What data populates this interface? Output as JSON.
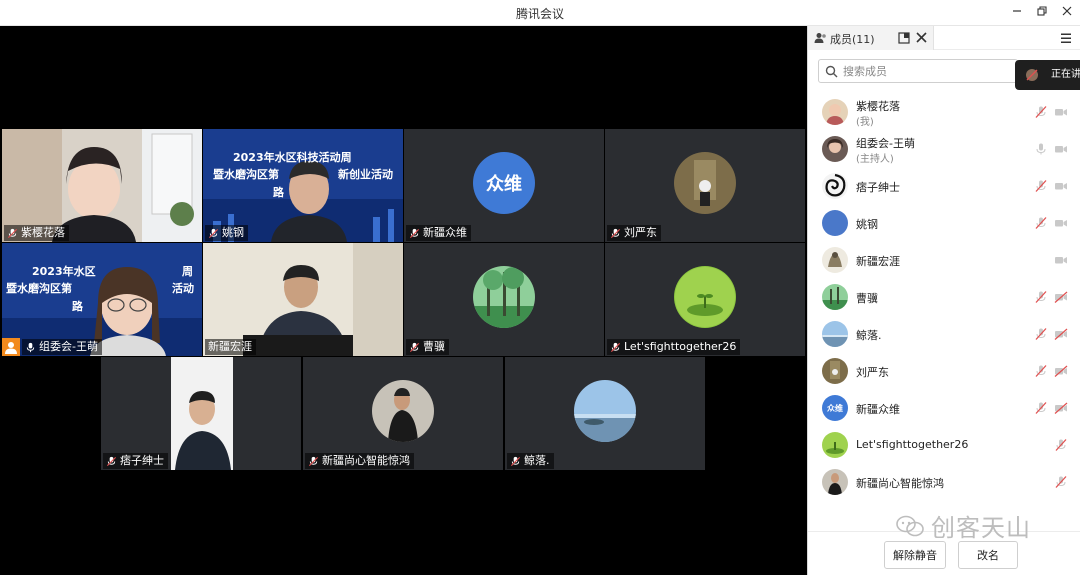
{
  "window": {
    "title": "腾讯会议"
  },
  "tiles": [
    {
      "name": "紫樱花落"
    },
    {
      "name": "姚钢",
      "banner_line1": "2023年水区科技活动周",
      "banner_line2": "暨水磨沟区第",
      "banner_line2b": "新创业活动",
      "banner_line3": "路"
    },
    {
      "name": "新疆众维",
      "avatar_text": "众维"
    },
    {
      "name": "刘严东"
    },
    {
      "name": "组委会-王萌",
      "banner_line1": "2023年水区",
      "banner_line1b": "周",
      "banner_line2": "暨水磨沟区第",
      "banner_line2b": "活动",
      "banner_line3": "路"
    },
    {
      "name": "新疆宏涯"
    },
    {
      "name": "曹骥"
    },
    {
      "name": "Let'sfighttogether26"
    },
    {
      "name": "痞子绅士"
    },
    {
      "name": "新疆尚心智能惊鸿"
    },
    {
      "name": "鲸落."
    }
  ],
  "panel": {
    "tab_label": "成员(11)",
    "search_placeholder": "搜索成员",
    "speaking_label": "正在讲",
    "members": [
      {
        "name": "紫樱花落",
        "sub": "(我)"
      },
      {
        "name": "组委会-王萌",
        "sub": "(主持人)"
      },
      {
        "name": "痞子绅士"
      },
      {
        "name": "姚钢"
      },
      {
        "name": "新疆宏涯"
      },
      {
        "name": "曹骥"
      },
      {
        "name": "鲸落."
      },
      {
        "name": "刘严东"
      },
      {
        "name": "新疆众维",
        "avatar_text": "众维"
      },
      {
        "name": "Let'sfighttogether26"
      },
      {
        "name": "新疆尚心智能惊鸿"
      }
    ],
    "unmute_label": "解除静音",
    "rename_label": "改名"
  },
  "watermark": {
    "text": "创客天山"
  },
  "colors": {
    "active_border": "#2db55d",
    "host_badge": "#f28a1d",
    "tile_bg": "#2b2d31",
    "muted_red": "#e05050"
  }
}
